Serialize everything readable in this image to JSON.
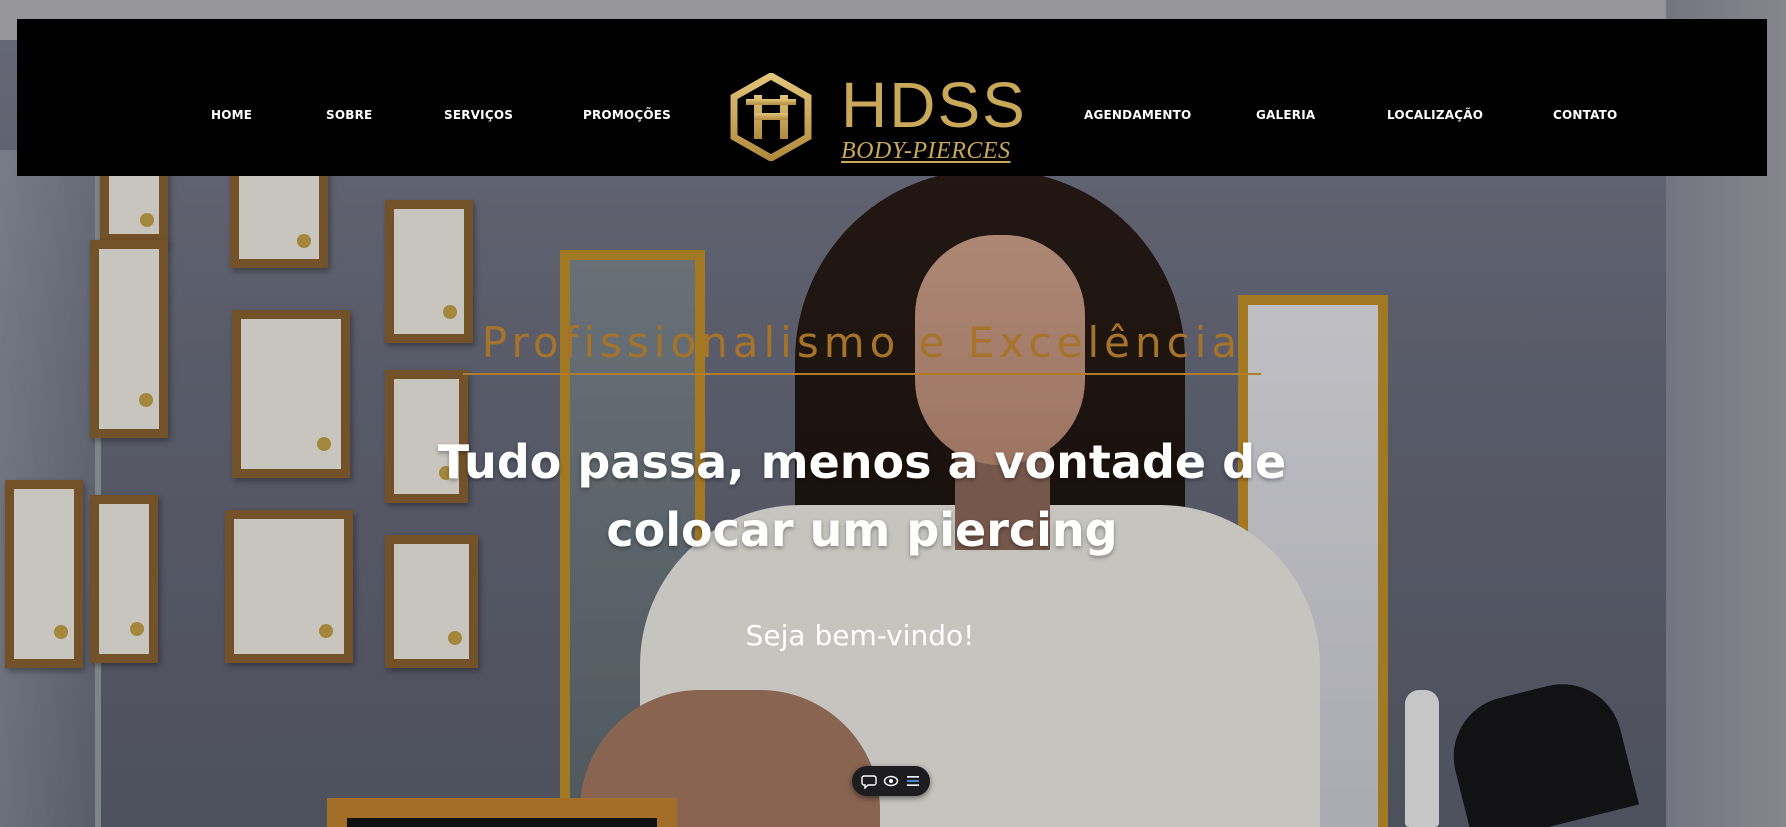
{
  "colors": {
    "header_bg": "#000000",
    "nav_text": "#ffffff",
    "brand_gold": "#c9a85a",
    "accent_gold": "#a5732a",
    "hero_text": "#ffffff"
  },
  "nav": {
    "left": [
      {
        "label": "HOME"
      },
      {
        "label": "SOBRE"
      },
      {
        "label": "SERVIÇOS"
      },
      {
        "label": "PROMOÇÕES"
      }
    ],
    "right": [
      {
        "label": "AGENDAMENTO"
      },
      {
        "label": "GALERIA"
      },
      {
        "label": "LOCALIZAÇÃO"
      },
      {
        "label": "CONTATO"
      }
    ]
  },
  "logo": {
    "title": "HDSS",
    "subtitle": "BODY-PIERCES",
    "icon": "hexagon-h-monogram-icon"
  },
  "hero": {
    "kicker": "Profissionalismo e Excelência",
    "title_line1": "Tudo passa, menos a vontade de",
    "title_line2": "colocar um piercing",
    "welcome": "Seja bem-vindo!"
  },
  "toolbar": {
    "icons": [
      "chat-bubble-icon",
      "eye-icon",
      "menu-list-icon"
    ]
  }
}
